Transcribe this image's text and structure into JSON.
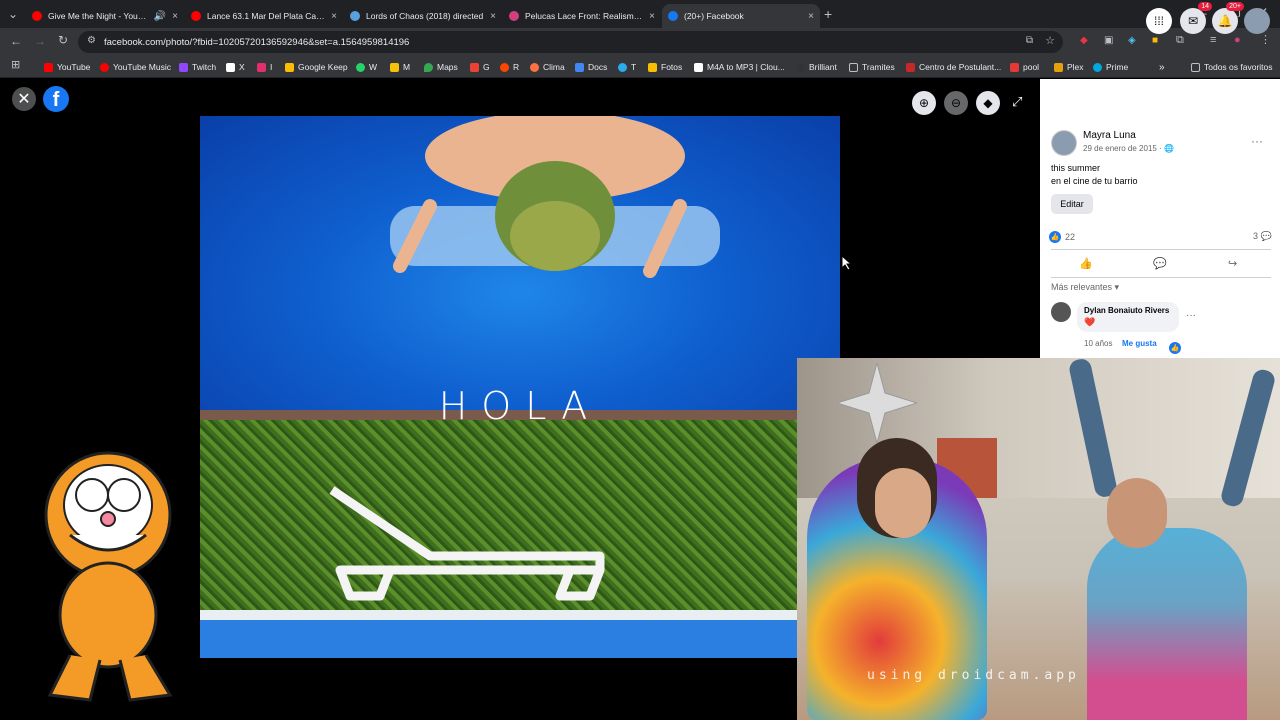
{
  "browser": {
    "tabs": [
      {
        "title": "Give Me the Night - YouTube",
        "fav_color": "#ff0000",
        "active": false
      },
      {
        "title": "Lance 63.1 Mar Del Plata Canyo",
        "fav_color": "#ff0000",
        "active": false
      },
      {
        "title": "Lords of Chaos (2018) directed",
        "fav_color": "#5aa0e0",
        "active": false
      },
      {
        "title": "Pelucas Lace Front: Realismo y",
        "fav_color": "#d04080",
        "active": false
      },
      {
        "title": "(20+) Facebook",
        "fav_color": "#1877f2",
        "active": true
      }
    ],
    "url": "facebook.com/photo/?fbid=10205720136592946&set=a.1564959814196",
    "bookmarks": [
      {
        "label": "YouTube",
        "color": "#ff0000"
      },
      {
        "label": "YouTube Music",
        "color": "#ff0000"
      },
      {
        "label": "Twitch",
        "color": "#9146ff"
      },
      {
        "label": "X",
        "color": "#ffffff"
      },
      {
        "label": "I",
        "color": "#e1306c"
      },
      {
        "label": "Google Keep",
        "color": "#fbbc04"
      },
      {
        "label": "W",
        "color": "#25d366"
      },
      {
        "label": "M",
        "color": "#f4c20d"
      },
      {
        "label": "Maps",
        "color": "#34a853"
      },
      {
        "label": "G",
        "color": "#ea4335"
      },
      {
        "label": "R",
        "color": "#ff4500"
      },
      {
        "label": "Clima",
        "color": "#ff7043"
      },
      {
        "label": "Docs",
        "color": "#4285f4"
      },
      {
        "label": "T",
        "color": "#2aabee"
      },
      {
        "label": "Fotos",
        "color": "#fbbc04"
      },
      {
        "label": "M4A to MP3 | Clou...",
        "color": "#ffffff"
      },
      {
        "label": "Brilliant",
        "color": "#333333"
      },
      {
        "label": "Tramites",
        "color": "#bdc1c6"
      },
      {
        "label": "Centro de Postulant...",
        "color": "#c62828"
      },
      {
        "label": "pool",
        "color": "#e53935"
      },
      {
        "label": "Plex",
        "color": "#e5a00d"
      },
      {
        "label": "Prime",
        "color": "#00a8e1"
      }
    ],
    "all_bookmarks": "Todos os favoritos"
  },
  "viewer": {
    "photo_text": "HOLA"
  },
  "facebook": {
    "messenger_badge": "14",
    "notif_badge": "20+",
    "author": "Mayra Luna",
    "date": "29 de enero de 2015 ·",
    "caption_line1": "this summer",
    "caption_line2": "en el cine de tu barrio",
    "edit_label": "Editar",
    "reactions_count": "22",
    "comments_count": "3",
    "sort_label": "Más relevantes",
    "comment": {
      "name": "Dylan Bonaiuto Rivers",
      "text": "❤️",
      "age": "10 años",
      "like_label": "Me gusta"
    }
  },
  "webcam": {
    "watermark": "using droidcam.app"
  }
}
